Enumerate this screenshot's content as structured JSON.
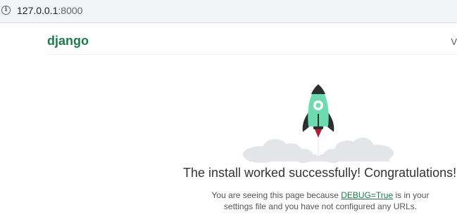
{
  "browser": {
    "url_host": "127.0.0.1",
    "url_port": ":8000"
  },
  "header": {
    "logo": "django",
    "release_link_partial": "V"
  },
  "main": {
    "headline": "The install worked successfully! Congratulations!",
    "sub_before": "You are seeing this page because ",
    "sub_link": "DEBUG=True",
    "sub_after_line1": " is in your",
    "sub_line2": "settings file and you have not configured any URLs."
  },
  "colors": {
    "brand_green": "#1e7a4c",
    "rocket_body": "#6cdbb0",
    "rocket_dark": "#29302f",
    "flame": "#b11e3a",
    "cloud": "#e3e5e8"
  }
}
